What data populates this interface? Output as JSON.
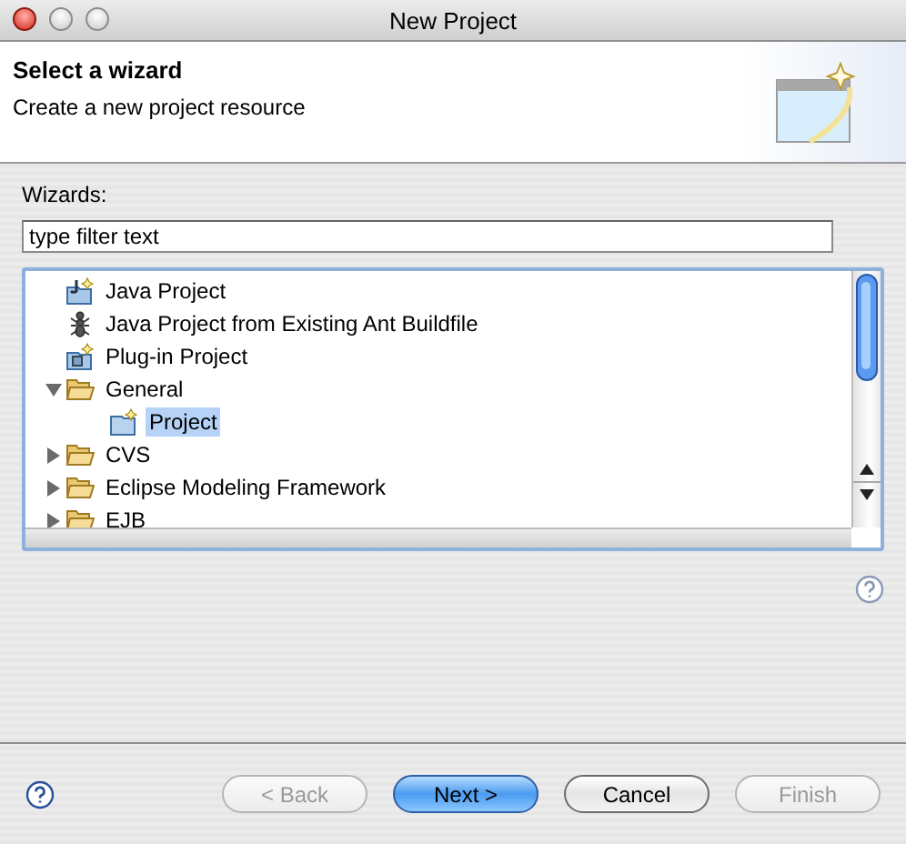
{
  "window": {
    "title": "New Project"
  },
  "header": {
    "title": "Select a wizard",
    "subtitle": "Create a new project resource"
  },
  "wizards": {
    "label": "Wizards:",
    "filter": {
      "value": "type filter text"
    },
    "tree": [
      {
        "label": "Java Project",
        "kind": "java-project",
        "selected": false
      },
      {
        "label": "Java Project from Existing Ant Buildfile",
        "kind": "ant",
        "selected": false
      },
      {
        "label": "Plug-in Project",
        "kind": "plugin",
        "selected": false
      },
      {
        "label": "General",
        "kind": "folder",
        "selected": false,
        "expanded": true,
        "children": [
          {
            "label": "Project",
            "kind": "project",
            "selected": true
          }
        ]
      },
      {
        "label": "CVS",
        "kind": "folder",
        "selected": false,
        "expanded": false
      },
      {
        "label": "Eclipse Modeling Framework",
        "kind": "folder",
        "selected": false,
        "expanded": false
      },
      {
        "label": "EJB",
        "kind": "folder",
        "selected": false,
        "expanded": false
      }
    ]
  },
  "buttons": [
    {
      "label": "< Back",
      "disabled": true,
      "default": false
    },
    {
      "label": "Next >",
      "disabled": false,
      "default": true
    },
    {
      "label": "Cancel",
      "disabled": false,
      "default": false
    },
    {
      "label": "Finish",
      "disabled": true,
      "default": false
    }
  ]
}
